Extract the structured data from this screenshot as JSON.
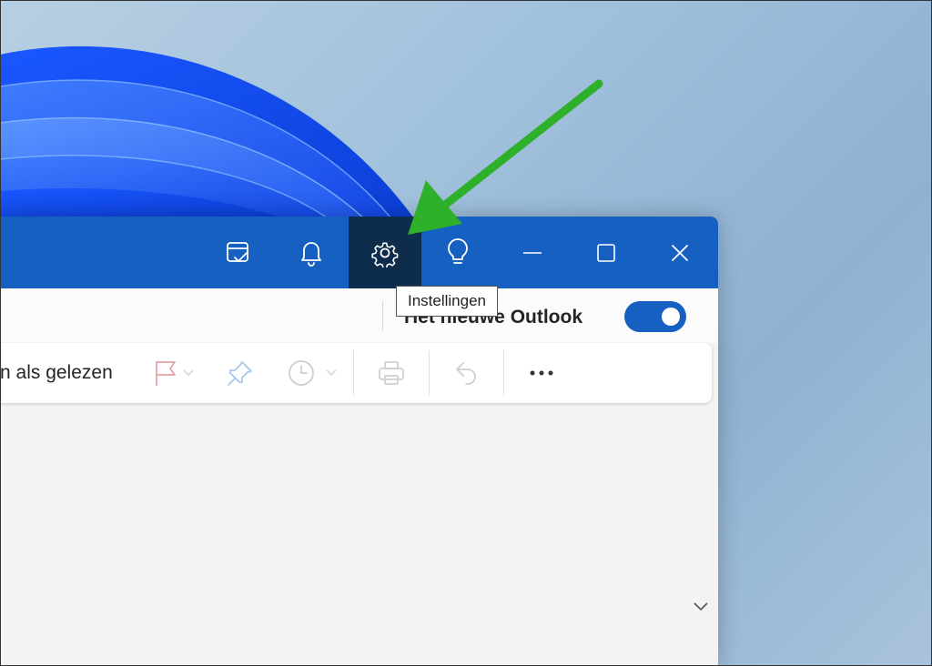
{
  "tooltip": {
    "text": "Instellingen"
  },
  "toggle": {
    "label": "Het nieuwe Outlook",
    "state": "on"
  },
  "toolbar": {
    "mark_read_text": "n als gelezen"
  },
  "titlebar_buttons": [
    "todo-icon",
    "bell-icon",
    "gear-icon",
    "lightbulb-icon",
    "minimize-icon",
    "maximize-icon",
    "close-icon"
  ],
  "colors": {
    "accent": "#1660c2",
    "active_button": "#0e2c4b",
    "annotation_arrow": "#2eb02b"
  }
}
